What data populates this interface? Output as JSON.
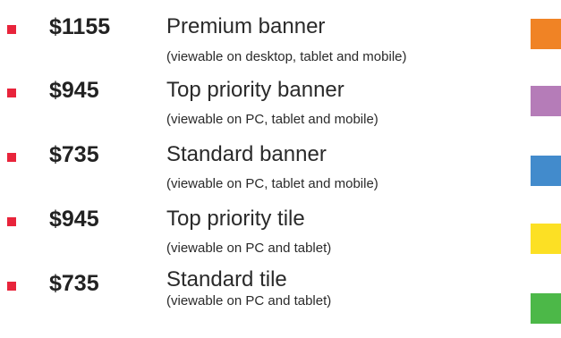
{
  "packages": [
    {
      "price": "$1155",
      "name": "Premium banner",
      "note": "(viewable on desktop, tablet and mobile)",
      "color": "#f08325"
    },
    {
      "price": "$945",
      "name": "Top priority banner",
      "note": "(viewable on PC, tablet and mobile)",
      "color": "#b57cb8"
    },
    {
      "price": "$735",
      "name": "Standard banner",
      "note": "(viewable on PC, tablet and mobile)",
      "color": "#428bcc"
    },
    {
      "price": "$945",
      "name": "Top priority tile",
      "note": "(viewable on PC and tablet)",
      "color": "#fce024"
    },
    {
      "price": "$735",
      "name": "Standard tile",
      "note": "(viewable on PC and tablet)",
      "color": "#4cb848"
    }
  ]
}
